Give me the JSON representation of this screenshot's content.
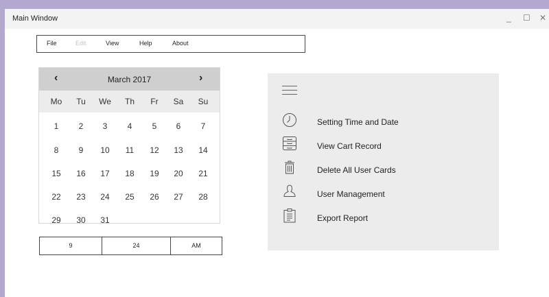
{
  "window": {
    "title": "Main Window",
    "controls": {
      "minimize": "_",
      "maximize": "☐",
      "close": "✕"
    }
  },
  "menu": {
    "items": [
      "File",
      "Edit",
      "View",
      "Help",
      "About"
    ],
    "disabled": [
      "Edit"
    ]
  },
  "calendar": {
    "month_label": "March 2017",
    "prev": "‹",
    "next": "›",
    "weekdays": [
      "Mo",
      "Tu",
      "We",
      "Th",
      "Fr",
      "Sa",
      "Su"
    ],
    "weeks": [
      [
        "1",
        "2",
        "3",
        "4",
        "5",
        "6",
        "7"
      ],
      [
        "8",
        "9",
        "10",
        "11",
        "12",
        "13",
        "14"
      ],
      [
        "15",
        "16",
        "17",
        "18",
        "19",
        "20",
        "21"
      ],
      [
        "22",
        "23",
        "24",
        "25",
        "26",
        "27",
        "28"
      ],
      [
        "29",
        "30",
        "31"
      ]
    ]
  },
  "time": {
    "hour": "9",
    "minute": "24",
    "ampm": "AM"
  },
  "side_menu": {
    "items": [
      {
        "label": "Setting Time and Date",
        "icon": "clock-icon"
      },
      {
        "label": "View Cart Record",
        "icon": "cabinet-icon"
      },
      {
        "label": "Delete All User Cards",
        "icon": "trash-icon"
      },
      {
        "label": "User Management",
        "icon": "user-icon"
      },
      {
        "label": "Export Report",
        "icon": "clipboard-icon"
      }
    ]
  },
  "colors": {
    "desktop": "#b3a9cf",
    "titlebar": "#f3f3f3",
    "calendar_header": "#cfcfcf",
    "calendar_weekdays": "#ececec",
    "panel": "#ececec"
  }
}
